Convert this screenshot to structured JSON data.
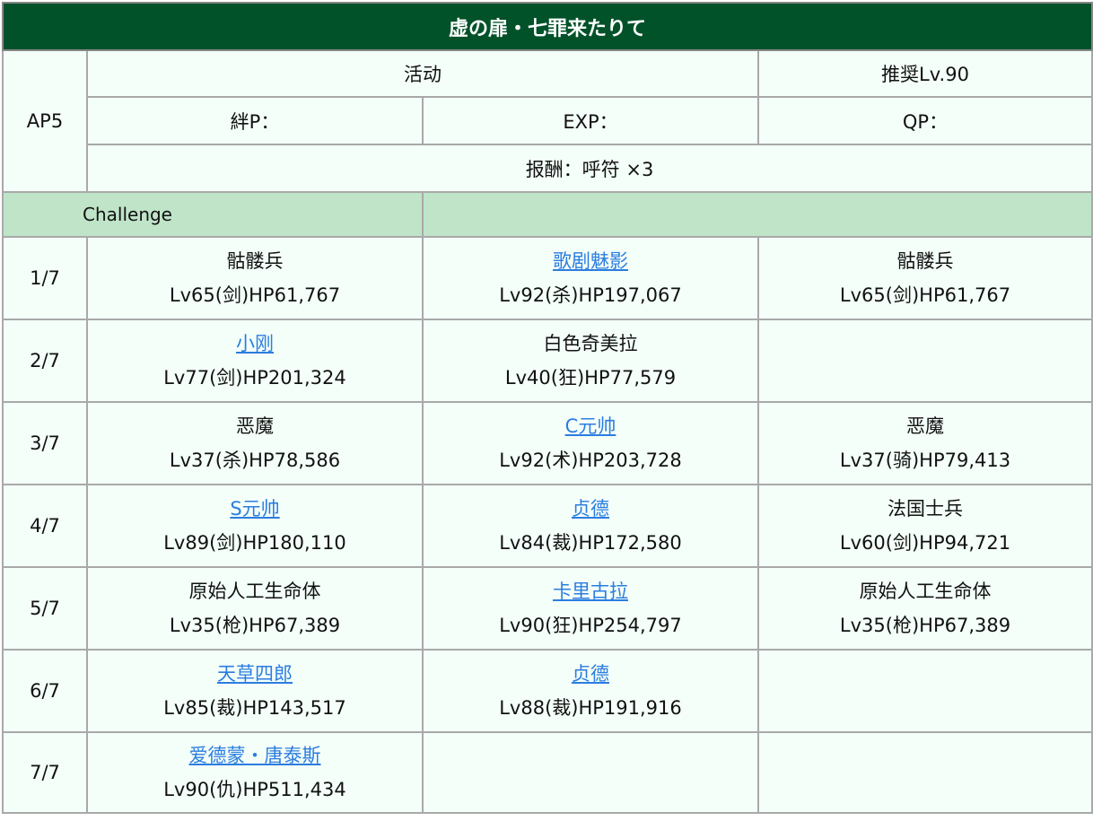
{
  "title": "虚の扉・七罪来たりて",
  "ap": "AP5",
  "activity": "活动",
  "recommended": "推奨Lv.90",
  "bond": "絆P：",
  "exp": "EXP：",
  "qp": "QP：",
  "reward": "报酬：呼符 ×3",
  "challenge_label": "Challenge",
  "colors": {
    "header": "#015229",
    "challenge_bg": "#bfe4c8",
    "cell_bg": "#f4fff9",
    "link": "#2b7de0"
  },
  "rows": [
    {
      "stage": "1/7",
      "enemies": [
        {
          "name": "骷髅兵",
          "stats": "Lv65(剑)HP61,767",
          "link": false
        },
        {
          "name": "歌剧魅影",
          "stats": "Lv92(杀)HP197,067",
          "link": true
        },
        {
          "name": "骷髅兵",
          "stats": "Lv65(剑)HP61,767",
          "link": false
        }
      ]
    },
    {
      "stage": "2/7",
      "enemies": [
        {
          "name": "小刚",
          "stats": "Lv77(剑)HP201,324",
          "link": true
        },
        {
          "name": "白色奇美拉",
          "stats": "Lv40(狂)HP77,579",
          "link": false
        },
        {
          "name": "",
          "stats": "",
          "link": false
        }
      ]
    },
    {
      "stage": "3/7",
      "enemies": [
        {
          "name": "恶魔",
          "stats": "Lv37(杀)HP78,586",
          "link": false
        },
        {
          "name": "C元帅",
          "stats": "Lv92(术)HP203,728",
          "link": true
        },
        {
          "name": "恶魔",
          "stats": "Lv37(骑)HP79,413",
          "link": false
        }
      ]
    },
    {
      "stage": "4/7",
      "enemies": [
        {
          "name": "S元帅",
          "stats": "Lv89(剑)HP180,110",
          "link": true
        },
        {
          "name": "贞德",
          "stats": "Lv84(裁)HP172,580",
          "link": true
        },
        {
          "name": "法国士兵",
          "stats": "Lv60(剑)HP94,721",
          "link": false
        }
      ]
    },
    {
      "stage": "5/7",
      "enemies": [
        {
          "name": "原始人工生命体",
          "stats": "Lv35(枪)HP67,389",
          "link": false
        },
        {
          "name": "卡里古拉",
          "stats": "Lv90(狂)HP254,797",
          "link": true
        },
        {
          "name": "原始人工生命体",
          "stats": "Lv35(枪)HP67,389",
          "link": false
        }
      ]
    },
    {
      "stage": "6/7",
      "enemies": [
        {
          "name": "天草四郎",
          "stats": "Lv85(裁)HP143,517",
          "link": true
        },
        {
          "name": "贞德",
          "stats": "Lv88(裁)HP191,916",
          "link": true
        },
        {
          "name": "",
          "stats": "",
          "link": false
        }
      ]
    },
    {
      "stage": "7/7",
      "enemies": [
        {
          "name": "爱德蒙・唐泰斯",
          "stats": "Lv90(仇)HP511,434",
          "link": true
        },
        {
          "name": "",
          "stats": "",
          "link": false
        },
        {
          "name": "",
          "stats": "",
          "link": false
        }
      ]
    }
  ]
}
